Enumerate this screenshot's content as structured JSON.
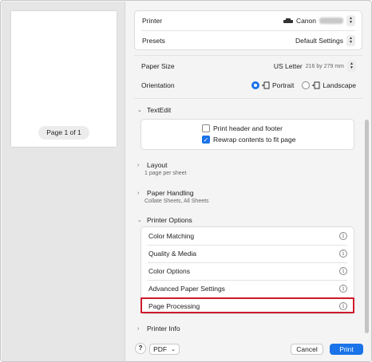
{
  "preview": {
    "page_label": "Page 1 of 1"
  },
  "printer": {
    "label": "Printer",
    "value": "Canon"
  },
  "presets": {
    "label": "Presets",
    "value": "Default Settings"
  },
  "paper_size": {
    "label": "Paper Size",
    "value": "US Letter",
    "detail": "216 by 279 mm"
  },
  "orientation": {
    "label": "Orientation",
    "portrait": "Portrait",
    "landscape": "Landscape",
    "selected": "Portrait"
  },
  "textedit": {
    "title": "TextEdit",
    "print_header_footer": "Print header and footer",
    "print_header_footer_checked": false,
    "rewrap": "Rewrap contents to fit page",
    "rewrap_checked": true
  },
  "layout": {
    "title": "Layout",
    "summary": "1 page per sheet"
  },
  "paper_handling": {
    "title": "Paper Handling",
    "summary": "Collate Sheets, All Sheets"
  },
  "printer_options": {
    "title": "Printer Options",
    "items": [
      "Color Matching",
      "Quality & Media",
      "Color Options",
      "Advanced Paper Settings",
      "Page Processing"
    ],
    "highlighted": "Page Processing"
  },
  "printer_info": {
    "title": "Printer Info"
  },
  "footer": {
    "help": "?",
    "pdf": "PDF",
    "cancel": "Cancel",
    "print": "Print"
  },
  "colors": {
    "accent": "#1a73e8",
    "highlight": "#d0192c"
  },
  "icons": {
    "chevron_right": "chevron-right-icon",
    "chevron_down": "chevron-down-icon",
    "info": "info-icon",
    "stepper": "stepper-icon",
    "portrait": "portrait-icon",
    "landscape": "landscape-icon"
  }
}
